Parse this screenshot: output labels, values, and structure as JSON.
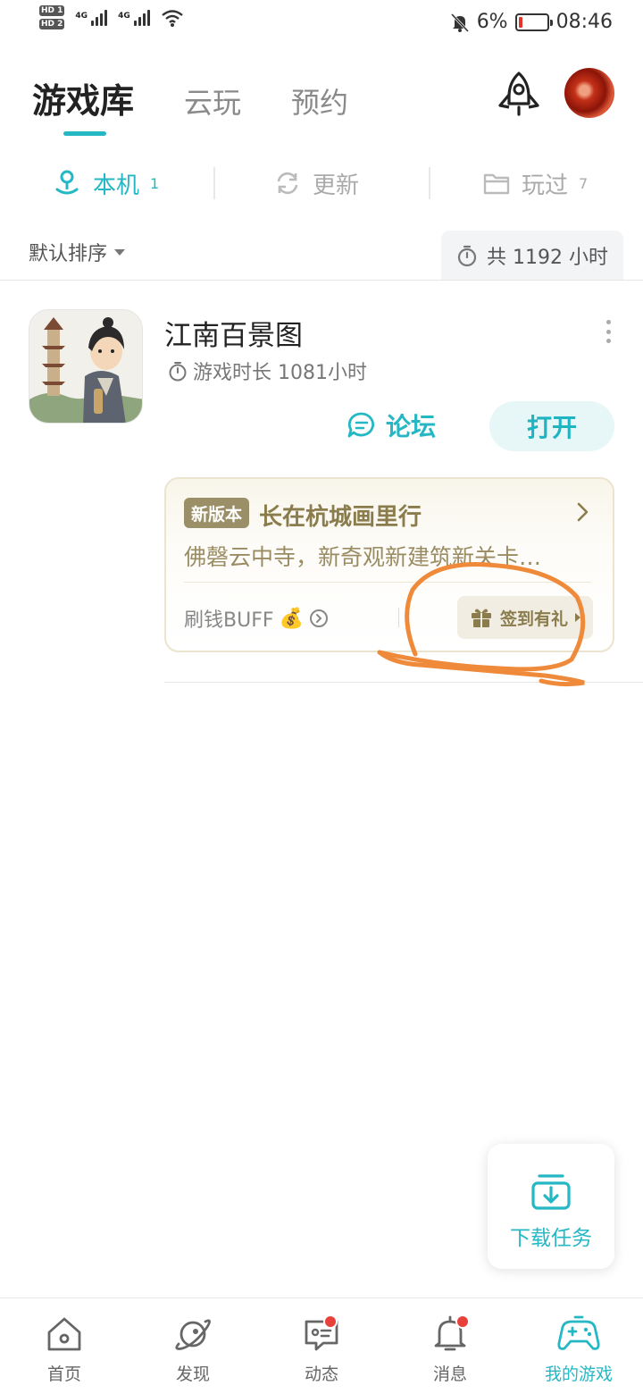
{
  "status_bar": {
    "hd1": "HD 1",
    "hd2": "HD 2",
    "net1": "4G",
    "net2": "4G",
    "battery": "6%",
    "time": "08:46"
  },
  "header": {
    "tabs": [
      {
        "label": "游戏库",
        "active": true
      },
      {
        "label": "云玩",
        "active": false
      },
      {
        "label": "预约",
        "active": false
      }
    ],
    "rocket_icon": "rocket-icon",
    "avatar": "user-avatar"
  },
  "subtabs": [
    {
      "label": "本机",
      "count": "1",
      "icon": "location-pin-icon",
      "active": true
    },
    {
      "label": "更新",
      "count": "",
      "icon": "refresh-icon",
      "active": false
    },
    {
      "label": "玩过",
      "count": "7",
      "icon": "folder-icon",
      "active": false
    }
  ],
  "sort": {
    "label": "默认排序"
  },
  "total": {
    "label": "共 1192 小时"
  },
  "game": {
    "title": "江南百景图",
    "playtime": "游戏时长 1081小时",
    "forum_label": "论坛",
    "open_label": "打开",
    "card": {
      "badge": "新版本",
      "title": "长在杭城画里行",
      "desc": "佛磬云中寺，新奇观新建筑新关卡…",
      "buff_label": "刷钱BUFF",
      "buff_emoji": "💰",
      "signin_label": "签到有礼"
    }
  },
  "download_task": {
    "label": "下载任务"
  },
  "bottom_nav": [
    {
      "label": "首页",
      "icon": "home-icon",
      "active": false,
      "dot": false
    },
    {
      "label": "发现",
      "icon": "planet-icon",
      "active": false,
      "dot": false
    },
    {
      "label": "动态",
      "icon": "chat-icon",
      "active": false,
      "dot": true
    },
    {
      "label": "消息",
      "icon": "bell-icon",
      "active": false,
      "dot": true
    },
    {
      "label": "我的游戏",
      "icon": "gamepad-icon",
      "active": true,
      "dot": false
    }
  ],
  "colors": {
    "accent": "#25b8c4",
    "card_gold": "#8a7c4c",
    "badge_bg": "#9a8f66",
    "notification_dot": "#e8413a",
    "annotation": "#ef8a3a"
  }
}
